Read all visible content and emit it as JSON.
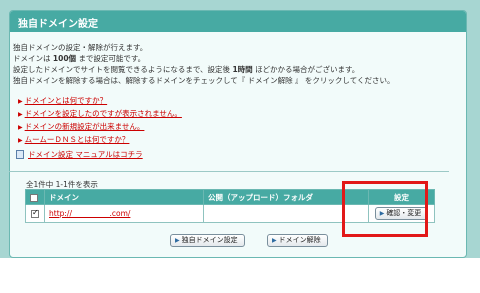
{
  "page": {
    "title": "独自ドメイン設定",
    "desc_line1": "独自ドメインの設定・解除が行えます。",
    "desc_line2_a": "ドメインは",
    "desc_line2_b": "100個",
    "desc_line2_c": "まで設定可能です。",
    "desc_line3_a": "設定したドメインでサイトを閲覧できるようになるまで、設定後",
    "desc_line3_b": "1時間",
    "desc_line3_c": "ほどかかる場合がございます。",
    "desc_line4": "独自ドメインを解除する場合は、解除するドメインをチェックして『 ドメイン解除 』 をクリックしてください。"
  },
  "faq": [
    "ドメインとは何ですか？",
    "ドメインを設定したのですが表示されません。",
    "ドメインの新規設定が出来ません。",
    "ムームーＤＮＳとは何ですか？"
  ],
  "manual_link": "ドメイン設定 マニュアルはコチラ",
  "list": {
    "count": "全1件中 1-1件を表示",
    "headers": {
      "domain": "ドメイン",
      "public_folder": "公開（アップロード）フォルダ",
      "settings": "設定"
    },
    "rows": [
      {
        "checked": true,
        "domain": "http://　　　　　.com/",
        "public_folder": "",
        "action": "確認・変更"
      }
    ]
  },
  "buttons": {
    "add": "独自ドメイン設定",
    "remove": "ドメイン解除"
  },
  "colors": {
    "header": "#47aaa3",
    "link": "#cc0000",
    "highlight": "#e21818"
  }
}
